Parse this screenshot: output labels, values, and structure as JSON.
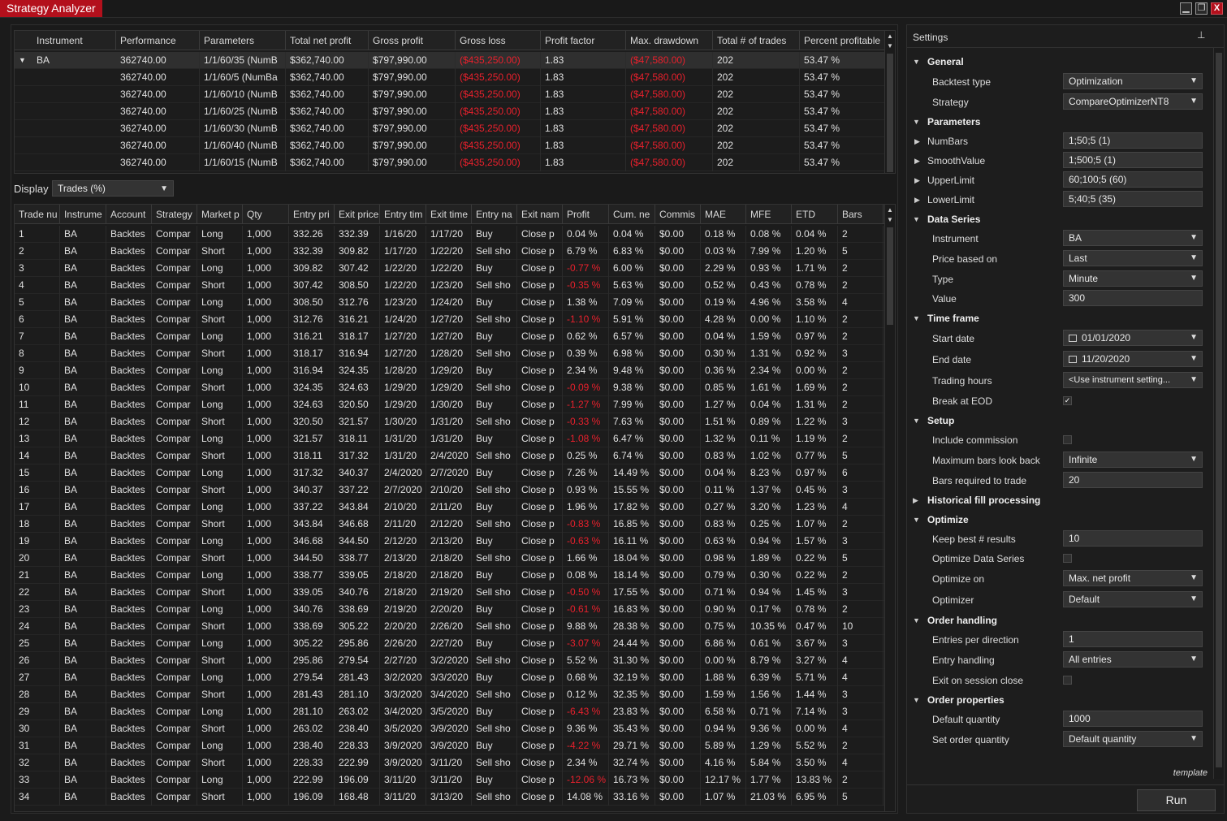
{
  "app": {
    "title": "Strategy Analyzer",
    "window_buttons": [
      "▁",
      "❐",
      "X"
    ]
  },
  "results": {
    "headers": [
      "Instrument",
      "Performance",
      "Parameters",
      "Total net profit",
      "Gross profit",
      "Gross loss",
      "Profit factor",
      "Max. drawdown",
      "Total # of trades",
      "Percent profitable"
    ],
    "rows": [
      [
        "BA",
        "362740.00",
        "1/1/60/35 (NumB",
        "$362,740.00",
        "$797,990.00",
        "($435,250.00)",
        "1.83",
        "($47,580.00)",
        "202",
        "53.47 %"
      ],
      [
        "",
        "362740.00",
        "1/1/60/5 (NumBa",
        "$362,740.00",
        "$797,990.00",
        "($435,250.00)",
        "1.83",
        "($47,580.00)",
        "202",
        "53.47 %"
      ],
      [
        "",
        "362740.00",
        "1/1/60/10 (NumB",
        "$362,740.00",
        "$797,990.00",
        "($435,250.00)",
        "1.83",
        "($47,580.00)",
        "202",
        "53.47 %"
      ],
      [
        "",
        "362740.00",
        "1/1/60/25 (NumB",
        "$362,740.00",
        "$797,990.00",
        "($435,250.00)",
        "1.83",
        "($47,580.00)",
        "202",
        "53.47 %"
      ],
      [
        "",
        "362740.00",
        "1/1/60/30 (NumB",
        "$362,740.00",
        "$797,990.00",
        "($435,250.00)",
        "1.83",
        "($47,580.00)",
        "202",
        "53.47 %"
      ],
      [
        "",
        "362740.00",
        "1/1/60/40 (NumB",
        "$362,740.00",
        "$797,990.00",
        "($435,250.00)",
        "1.83",
        "($47,580.00)",
        "202",
        "53.47 %"
      ],
      [
        "",
        "362740.00",
        "1/1/60/15 (NumB",
        "$362,740.00",
        "$797,990.00",
        "($435,250.00)",
        "1.83",
        "($47,580.00)",
        "202",
        "53.47 %"
      ]
    ]
  },
  "display": {
    "label": "Display",
    "selected": "Trades (%)"
  },
  "trades": {
    "headers": [
      "Trade nu",
      "Instrume",
      "Account",
      "Strategy",
      "Market p",
      "Qty",
      "Entry pri",
      "Exit price",
      "Entry tim",
      "Exit time",
      "Entry na",
      "Exit nam",
      "Profit",
      "Cum. ne",
      "Commis",
      "MAE",
      "MFE",
      "ETD",
      "Bars"
    ],
    "rows": [
      [
        "1",
        "BA",
        "Backtes",
        "Compar",
        "Long",
        "1,000",
        "332.26",
        "332.39",
        "1/16/20",
        "1/17/20",
        "Buy",
        "Close p",
        "0.04 %",
        "0.04 %",
        "$0.00",
        "0.18 %",
        "0.08 %",
        "0.04 %",
        "2"
      ],
      [
        "2",
        "BA",
        "Backtes",
        "Compar",
        "Short",
        "1,000",
        "332.39",
        "309.82",
        "1/17/20",
        "1/22/20",
        "Sell sho",
        "Close p",
        "6.79 %",
        "6.83 %",
        "$0.00",
        "0.03 %",
        "7.99 %",
        "1.20 %",
        "5"
      ],
      [
        "3",
        "BA",
        "Backtes",
        "Compar",
        "Long",
        "1,000",
        "309.82",
        "307.42",
        "1/22/20",
        "1/22/20",
        "Buy",
        "Close p",
        "-0.77 %",
        "6.00 %",
        "$0.00",
        "2.29 %",
        "0.93 %",
        "1.71 %",
        "2"
      ],
      [
        "4",
        "BA",
        "Backtes",
        "Compar",
        "Short",
        "1,000",
        "307.42",
        "308.50",
        "1/22/20",
        "1/23/20",
        "Sell sho",
        "Close p",
        "-0.35 %",
        "5.63 %",
        "$0.00",
        "0.52 %",
        "0.43 %",
        "0.78 %",
        "2"
      ],
      [
        "5",
        "BA",
        "Backtes",
        "Compar",
        "Long",
        "1,000",
        "308.50",
        "312.76",
        "1/23/20",
        "1/24/20",
        "Buy",
        "Close p",
        "1.38 %",
        "7.09 %",
        "$0.00",
        "0.19 %",
        "4.96 %",
        "3.58 %",
        "4"
      ],
      [
        "6",
        "BA",
        "Backtes",
        "Compar",
        "Short",
        "1,000",
        "312.76",
        "316.21",
        "1/24/20",
        "1/27/20",
        "Sell sho",
        "Close p",
        "-1.10 %",
        "5.91 %",
        "$0.00",
        "4.28 %",
        "0.00 %",
        "1.10 %",
        "2"
      ],
      [
        "7",
        "BA",
        "Backtes",
        "Compar",
        "Long",
        "1,000",
        "316.21",
        "318.17",
        "1/27/20",
        "1/27/20",
        "Buy",
        "Close p",
        "0.62 %",
        "6.57 %",
        "$0.00",
        "0.04 %",
        "1.59 %",
        "0.97 %",
        "2"
      ],
      [
        "8",
        "BA",
        "Backtes",
        "Compar",
        "Short",
        "1,000",
        "318.17",
        "316.94",
        "1/27/20",
        "1/28/20",
        "Sell sho",
        "Close p",
        "0.39 %",
        "6.98 %",
        "$0.00",
        "0.30 %",
        "1.31 %",
        "0.92 %",
        "3"
      ],
      [
        "9",
        "BA",
        "Backtes",
        "Compar",
        "Long",
        "1,000",
        "316.94",
        "324.35",
        "1/28/20",
        "1/29/20",
        "Buy",
        "Close p",
        "2.34 %",
        "9.48 %",
        "$0.00",
        "0.36 %",
        "2.34 %",
        "0.00 %",
        "2"
      ],
      [
        "10",
        "BA",
        "Backtes",
        "Compar",
        "Short",
        "1,000",
        "324.35",
        "324.63",
        "1/29/20",
        "1/29/20",
        "Sell sho",
        "Close p",
        "-0.09 %",
        "9.38 %",
        "$0.00",
        "0.85 %",
        "1.61 %",
        "1.69 %",
        "2"
      ],
      [
        "11",
        "BA",
        "Backtes",
        "Compar",
        "Long",
        "1,000",
        "324.63",
        "320.50",
        "1/29/20",
        "1/30/20",
        "Buy",
        "Close p",
        "-1.27 %",
        "7.99 %",
        "$0.00",
        "1.27 %",
        "0.04 %",
        "1.31 %",
        "2"
      ],
      [
        "12",
        "BA",
        "Backtes",
        "Compar",
        "Short",
        "1,000",
        "320.50",
        "321.57",
        "1/30/20",
        "1/31/20",
        "Sell sho",
        "Close p",
        "-0.33 %",
        "7.63 %",
        "$0.00",
        "1.51 %",
        "0.89 %",
        "1.22 %",
        "3"
      ],
      [
        "13",
        "BA",
        "Backtes",
        "Compar",
        "Long",
        "1,000",
        "321.57",
        "318.11",
        "1/31/20",
        "1/31/20",
        "Buy",
        "Close p",
        "-1.08 %",
        "6.47 %",
        "$0.00",
        "1.32 %",
        "0.11 %",
        "1.19 %",
        "2"
      ],
      [
        "14",
        "BA",
        "Backtes",
        "Compar",
        "Short",
        "1,000",
        "318.11",
        "317.32",
        "1/31/20",
        "2/4/2020",
        "Sell sho",
        "Close p",
        "0.25 %",
        "6.74 %",
        "$0.00",
        "0.83 %",
        "1.02 %",
        "0.77 %",
        "5"
      ],
      [
        "15",
        "BA",
        "Backtes",
        "Compar",
        "Long",
        "1,000",
        "317.32",
        "340.37",
        "2/4/2020",
        "2/7/2020",
        "Buy",
        "Close p",
        "7.26 %",
        "14.49 %",
        "$0.00",
        "0.04 %",
        "8.23 %",
        "0.97 %",
        "6"
      ],
      [
        "16",
        "BA",
        "Backtes",
        "Compar",
        "Short",
        "1,000",
        "340.37",
        "337.22",
        "2/7/2020",
        "2/10/20",
        "Sell sho",
        "Close p",
        "0.93 %",
        "15.55 %",
        "$0.00",
        "0.11 %",
        "1.37 %",
        "0.45 %",
        "3"
      ],
      [
        "17",
        "BA",
        "Backtes",
        "Compar",
        "Long",
        "1,000",
        "337.22",
        "343.84",
        "2/10/20",
        "2/11/20",
        "Buy",
        "Close p",
        "1.96 %",
        "17.82 %",
        "$0.00",
        "0.27 %",
        "3.20 %",
        "1.23 %",
        "4"
      ],
      [
        "18",
        "BA",
        "Backtes",
        "Compar",
        "Short",
        "1,000",
        "343.84",
        "346.68",
        "2/11/20",
        "2/12/20",
        "Sell sho",
        "Close p",
        "-0.83 %",
        "16.85 %",
        "$0.00",
        "0.83 %",
        "0.25 %",
        "1.07 %",
        "2"
      ],
      [
        "19",
        "BA",
        "Backtes",
        "Compar",
        "Long",
        "1,000",
        "346.68",
        "344.50",
        "2/12/20",
        "2/13/20",
        "Buy",
        "Close p",
        "-0.63 %",
        "16.11 %",
        "$0.00",
        "0.63 %",
        "0.94 %",
        "1.57 %",
        "3"
      ],
      [
        "20",
        "BA",
        "Backtes",
        "Compar",
        "Short",
        "1,000",
        "344.50",
        "338.77",
        "2/13/20",
        "2/18/20",
        "Sell sho",
        "Close p",
        "1.66 %",
        "18.04 %",
        "$0.00",
        "0.98 %",
        "1.89 %",
        "0.22 %",
        "5"
      ],
      [
        "21",
        "BA",
        "Backtes",
        "Compar",
        "Long",
        "1,000",
        "338.77",
        "339.05",
        "2/18/20",
        "2/18/20",
        "Buy",
        "Close p",
        "0.08 %",
        "18.14 %",
        "$0.00",
        "0.79 %",
        "0.30 %",
        "0.22 %",
        "2"
      ],
      [
        "22",
        "BA",
        "Backtes",
        "Compar",
        "Short",
        "1,000",
        "339.05",
        "340.76",
        "2/18/20",
        "2/19/20",
        "Sell sho",
        "Close p",
        "-0.50 %",
        "17.55 %",
        "$0.00",
        "0.71 %",
        "0.94 %",
        "1.45 %",
        "3"
      ],
      [
        "23",
        "BA",
        "Backtes",
        "Compar",
        "Long",
        "1,000",
        "340.76",
        "338.69",
        "2/19/20",
        "2/20/20",
        "Buy",
        "Close p",
        "-0.61 %",
        "16.83 %",
        "$0.00",
        "0.90 %",
        "0.17 %",
        "0.78 %",
        "2"
      ],
      [
        "24",
        "BA",
        "Backtes",
        "Compar",
        "Short",
        "1,000",
        "338.69",
        "305.22",
        "2/20/20",
        "2/26/20",
        "Sell sho",
        "Close p",
        "9.88 %",
        "28.38 %",
        "$0.00",
        "0.75 %",
        "10.35 %",
        "0.47 %",
        "10"
      ],
      [
        "25",
        "BA",
        "Backtes",
        "Compar",
        "Long",
        "1,000",
        "305.22",
        "295.86",
        "2/26/20",
        "2/27/20",
        "Buy",
        "Close p",
        "-3.07 %",
        "24.44 %",
        "$0.00",
        "6.86 %",
        "0.61 %",
        "3.67 %",
        "3"
      ],
      [
        "26",
        "BA",
        "Backtes",
        "Compar",
        "Short",
        "1,000",
        "295.86",
        "279.54",
        "2/27/20",
        "3/2/2020",
        "Sell sho",
        "Close p",
        "5.52 %",
        "31.30 %",
        "$0.00",
        "0.00 %",
        "8.79 %",
        "3.27 %",
        "4"
      ],
      [
        "27",
        "BA",
        "Backtes",
        "Compar",
        "Long",
        "1,000",
        "279.54",
        "281.43",
        "3/2/2020",
        "3/3/2020",
        "Buy",
        "Close p",
        "0.68 %",
        "32.19 %",
        "$0.00",
        "1.88 %",
        "6.39 %",
        "5.71 %",
        "4"
      ],
      [
        "28",
        "BA",
        "Backtes",
        "Compar",
        "Short",
        "1,000",
        "281.43",
        "281.10",
        "3/3/2020",
        "3/4/2020",
        "Sell sho",
        "Close p",
        "0.12 %",
        "32.35 %",
        "$0.00",
        "1.59 %",
        "1.56 %",
        "1.44 %",
        "3"
      ],
      [
        "29",
        "BA",
        "Backtes",
        "Compar",
        "Long",
        "1,000",
        "281.10",
        "263.02",
        "3/4/2020",
        "3/5/2020",
        "Buy",
        "Close p",
        "-6.43 %",
        "23.83 %",
        "$0.00",
        "6.58 %",
        "0.71 %",
        "7.14 %",
        "3"
      ],
      [
        "30",
        "BA",
        "Backtes",
        "Compar",
        "Short",
        "1,000",
        "263.02",
        "238.40",
        "3/5/2020",
        "3/9/2020",
        "Sell sho",
        "Close p",
        "9.36 %",
        "35.43 %",
        "$0.00",
        "0.94 %",
        "9.36 %",
        "0.00 %",
        "4"
      ],
      [
        "31",
        "BA",
        "Backtes",
        "Compar",
        "Long",
        "1,000",
        "238.40",
        "228.33",
        "3/9/2020",
        "3/9/2020",
        "Buy",
        "Close p",
        "-4.22 %",
        "29.71 %",
        "$0.00",
        "5.89 %",
        "1.29 %",
        "5.52 %",
        "2"
      ],
      [
        "32",
        "BA",
        "Backtes",
        "Compar",
        "Short",
        "1,000",
        "228.33",
        "222.99",
        "3/9/2020",
        "3/11/20",
        "Sell sho",
        "Close p",
        "2.34 %",
        "32.74 %",
        "$0.00",
        "4.16 %",
        "5.84 %",
        "3.50 %",
        "4"
      ],
      [
        "33",
        "BA",
        "Backtes",
        "Compar",
        "Long",
        "1,000",
        "222.99",
        "196.09",
        "3/11/20",
        "3/11/20",
        "Buy",
        "Close p",
        "-12.06 %",
        "16.73 %",
        "$0.00",
        "12.17 %",
        "1.77 %",
        "13.83 %",
        "2"
      ],
      [
        "34",
        "BA",
        "Backtes",
        "Compar",
        "Short",
        "1,000",
        "196.09",
        "168.48",
        "3/11/20",
        "3/13/20",
        "Sell sho",
        "Close p",
        "14.08 %",
        "33.16 %",
        "$0.00",
        "1.07 %",
        "21.03 %",
        "6.95 %",
        "5"
      ]
    ]
  },
  "settings": {
    "title": "Settings",
    "pin": "⊥",
    "template": "template",
    "run": "Run",
    "groups": {
      "general": "General",
      "parameters": "Parameters",
      "data_series": "Data Series",
      "time_frame": "Time frame",
      "setup": "Setup",
      "historical": "Historical fill processing",
      "optimize": "Optimize",
      "order_handling": "Order handling",
      "order_properties": "Order properties"
    },
    "fields": {
      "backtest_type": {
        "label": "Backtest type",
        "value": "Optimization"
      },
      "strategy": {
        "label": "Strategy",
        "value": "CompareOptimizerNT8"
      },
      "numbars": {
        "label": "NumBars",
        "value": "1;50;5 (1)"
      },
      "smoothvalue": {
        "label": "SmoothValue",
        "value": "1;500;5 (1)"
      },
      "upperlimit": {
        "label": "UpperLimit",
        "value": "60;100;5 (60)"
      },
      "lowerlimit": {
        "label": "LowerLimit",
        "value": "5;40;5 (35)"
      },
      "instrument": {
        "label": "Instrument",
        "value": "BA"
      },
      "price_based_on": {
        "label": "Price based on",
        "value": "Last"
      },
      "type": {
        "label": "Type",
        "value": "Minute"
      },
      "value": {
        "label": "Value",
        "value": "300"
      },
      "start_date": {
        "label": "Start date",
        "value": "01/01/2020"
      },
      "end_date": {
        "label": "End date",
        "value": "11/20/2020"
      },
      "trading_hours": {
        "label": "Trading hours",
        "value": "<Use instrument setting..."
      },
      "break_eod": {
        "label": "Break at EOD",
        "checked": "✓"
      },
      "include_commission": {
        "label": "Include commission",
        "checked": ""
      },
      "max_bars_lookback": {
        "label": "Maximum bars look back",
        "value": "Infinite"
      },
      "bars_required": {
        "label": "Bars required to trade",
        "value": "20"
      },
      "keep_best": {
        "label": "Keep best # results",
        "value": "10"
      },
      "optimize_data_series": {
        "label": "Optimize Data Series",
        "checked": ""
      },
      "optimize_on": {
        "label": "Optimize on",
        "value": "Max. net profit"
      },
      "optimizer": {
        "label": "Optimizer",
        "value": "Default"
      },
      "entries_per_direction": {
        "label": "Entries per direction",
        "value": "1"
      },
      "entry_handling": {
        "label": "Entry handling",
        "value": "All entries"
      },
      "exit_session_close": {
        "label": "Exit on session close",
        "checked": ""
      },
      "default_quantity": {
        "label": "Default quantity",
        "value": "1000"
      },
      "set_order_quantity": {
        "label": "Set order quantity",
        "value": "Default quantity"
      }
    }
  },
  "colors": {
    "accent": "#b3101c",
    "negative": "#e8202c",
    "background": "#1b1b1b"
  }
}
